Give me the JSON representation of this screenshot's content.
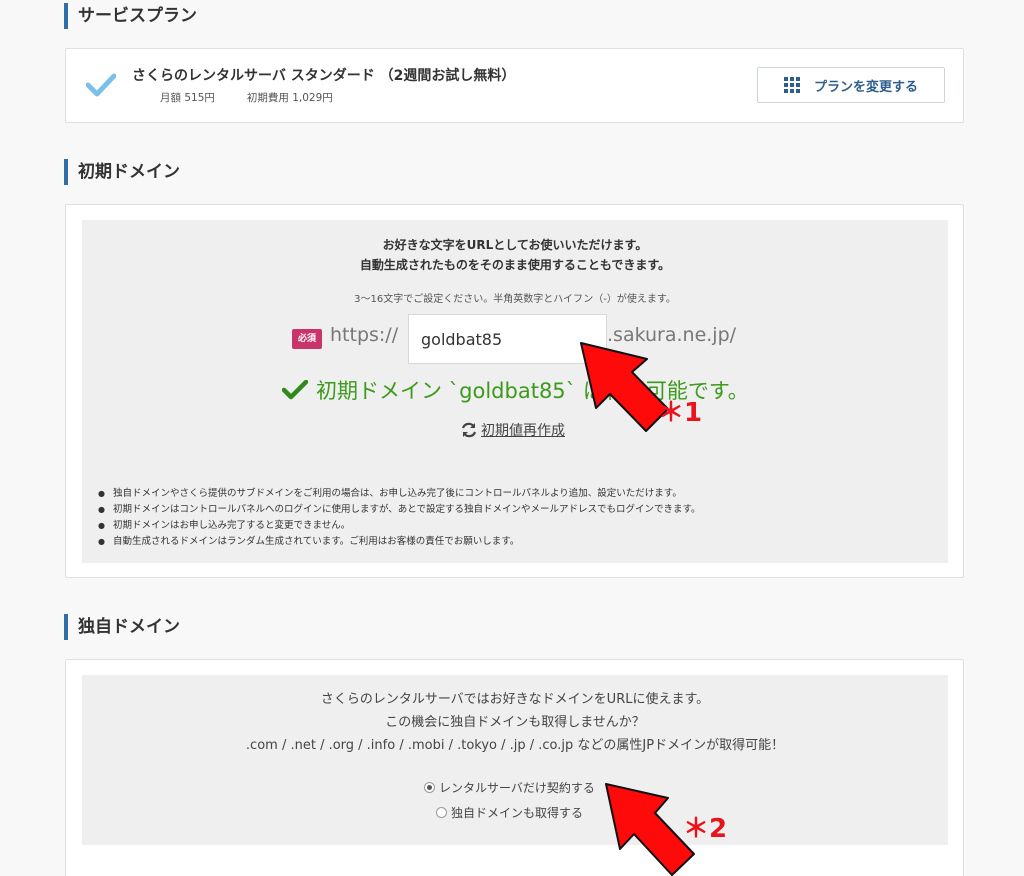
{
  "service_plan": {
    "section_title": "サービスプラン",
    "plan_name": "さくらのレンタルサーバ スタンダード （2週間お試し無料）",
    "monthly_fee": "月額 515円",
    "initial_fee": "初期費用 1,029円",
    "change_button_label": "プランを変更する"
  },
  "initial_domain": {
    "section_title": "初期ドメイン",
    "intro_line1": "お好きな文字をURLとしてお使いいただけます。",
    "intro_line2": "自動生成されたものをそのまま使用することもできます。",
    "hint": "3〜16文字でご設定ください。半角英数字とハイフン（-）が使えます。",
    "required_badge": "必須",
    "prefix": "https://",
    "input_value": "goldbat85",
    "suffix": ".sakura.ne.jp/",
    "availability_message": "初期ドメイン `goldbat85` は利用可能です。",
    "regenerate_label": "初期値再作成",
    "notes": [
      "独自ドメインやさくら提供のサブドメインをご利用の場合は、お申し込み完了後にコントロールパネルより追加、設定いただけます。",
      "初期ドメインはコントロールパネルへのログインに使用しますが、あとで設定する独自ドメインやメールアドレスでもログインできます。",
      "初期ドメインはお申し込み完了すると変更できません。",
      "自動生成されるドメインはランダム生成されています。ご利用はお客様の責任でお願いします。"
    ]
  },
  "custom_domain": {
    "section_title": "独自ドメイン",
    "line1": "さくらのレンタルサーバではお好きなドメインをURLに使えます。",
    "line2": "この機会に独自ドメインも取得しませんか？",
    "line3": ".com / .net / .org / .info / .mobi / .tokyo / .jp / .co.jp などの属性JPドメインが取得可能！",
    "options": [
      {
        "label": "レンタルサーバだけ契約する",
        "selected": true
      },
      {
        "label": "独自ドメインも取得する",
        "selected": false
      }
    ]
  },
  "annotations": {
    "mark1": "＊1",
    "mark2": "＊2"
  },
  "colors": {
    "accent": "#2f6fa6",
    "success": "#3c9a1c",
    "badge": "#c9356b",
    "annotation": "#e8141d"
  }
}
